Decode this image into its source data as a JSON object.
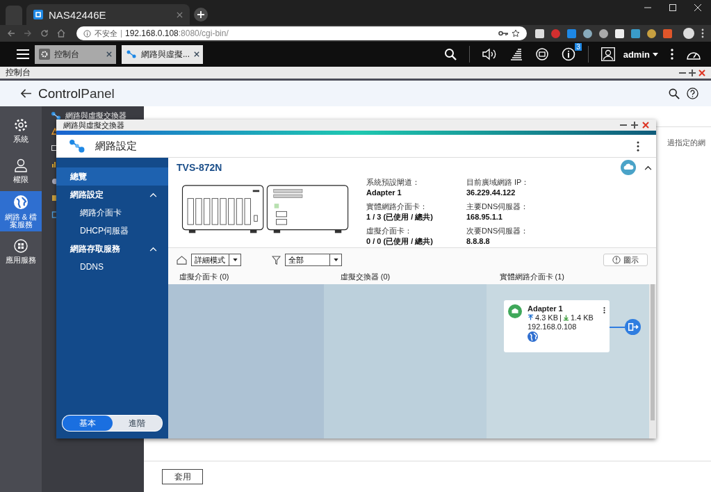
{
  "browser": {
    "tab_title": "NAS42446E",
    "security": "不安全",
    "url_host": "192.168.0.108",
    "url_rest": ":8080/cgi-bin/"
  },
  "app_tabs": [
    {
      "label": "控制台",
      "selected": false
    },
    {
      "label": "網路與虛擬...",
      "selected": true
    }
  ],
  "notifications": {
    "count": "3"
  },
  "user": "admin",
  "window": {
    "title": "控制台"
  },
  "control_panel": {
    "title_bold": "Control",
    "title_light": "Panel"
  },
  "rail": [
    {
      "label": "系統",
      "selected": false
    },
    {
      "label": "權限",
      "selected": false
    },
    {
      "label": "網路 & 檔案服務",
      "selected": true
    },
    {
      "label": "應用服務",
      "selected": false
    }
  ],
  "submenu": [
    {
      "label": "網路與虛擬交換器"
    }
  ],
  "main_text": "過指定的網",
  "apply_button": "套用",
  "network_window": {
    "title": "網路與虛擬交換器",
    "app_title": "網路設定",
    "nav": [
      {
        "label": "總覽",
        "kind": "item",
        "selected": true
      },
      {
        "label": "網路設定",
        "kind": "group",
        "expanded": true,
        "selected": false,
        "children": [
          {
            "label": "網路介面卡",
            "selected": false
          },
          {
            "label": "DHCP伺服器",
            "selected": false
          }
        ]
      },
      {
        "label": "網路存取服務",
        "kind": "group",
        "expanded": true,
        "selected": false,
        "children": [
          {
            "label": "DDNS",
            "selected": false
          }
        ]
      }
    ],
    "mode_toggle": [
      {
        "label": "基本",
        "selected": true
      },
      {
        "label": "進階",
        "selected": false
      }
    ],
    "device": {
      "name": "TVS-872N",
      "info_columns": [
        [
          {
            "label": "系統預設閘道：",
            "value": "Adapter 1"
          },
          {
            "label": "實體網路介面卡：",
            "value": "1 / 3 (已使用 / 總共)"
          },
          {
            "label": "虛擬介面卡：",
            "value": "0 / 0 (已使用 / 總共)"
          }
        ],
        [
          {
            "label": "目前廣域網路 IP：",
            "value": "36.229.44.122"
          },
          {
            "label": "主要DNS伺服器：",
            "value": "168.95.1.1"
          },
          {
            "label": "次要DNS伺服器：",
            "value": "8.8.8.8"
          }
        ]
      ]
    },
    "toolbar": {
      "mode": "詳細模式",
      "filter": "全部",
      "legend": "圖示"
    },
    "columns": [
      {
        "heading": "虛擬介面卡 (0)"
      },
      {
        "heading": "虛擬交換器 (0)"
      },
      {
        "heading": "實體網路介面卡 (1)"
      }
    ],
    "adapter": {
      "name": "Adapter 1",
      "upload": "4.3 KB",
      "separator": "|",
      "download": "1.4 KB",
      "ip": "192.168.0.108"
    }
  }
}
